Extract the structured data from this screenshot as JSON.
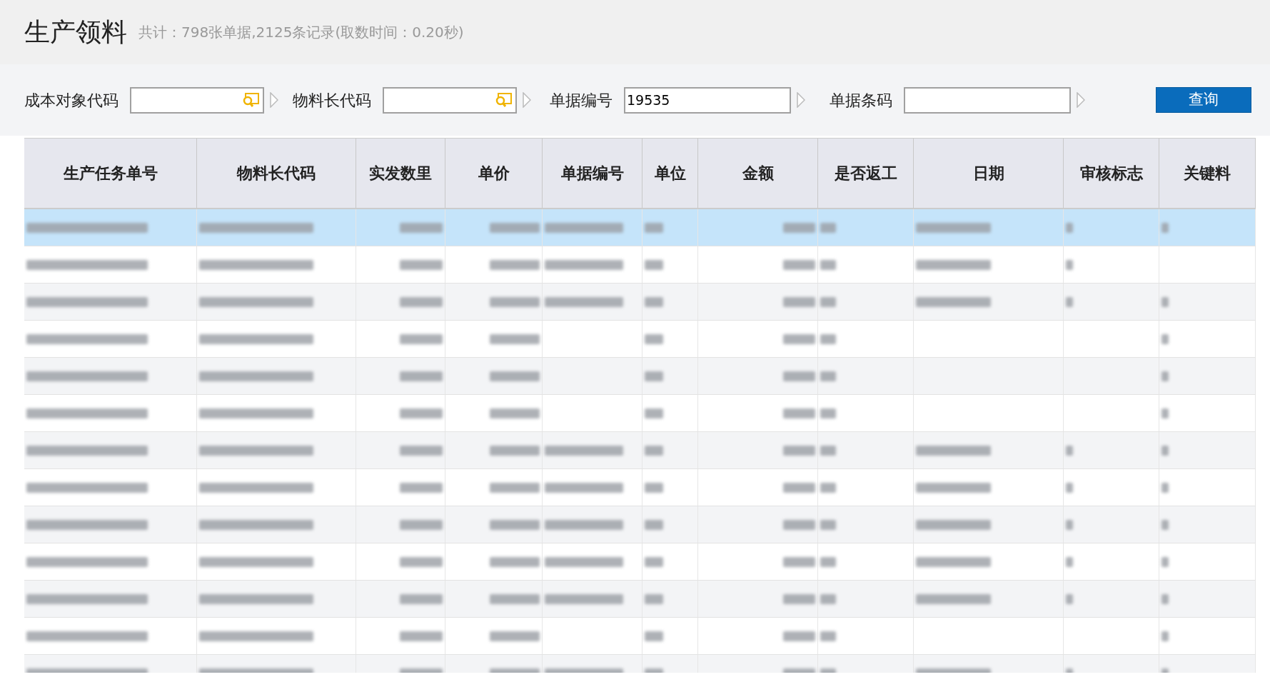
{
  "title": "生产领料",
  "summary": "共计：798张单据,2125条记录(取数时间：0.20秒)",
  "filters": [
    {
      "label": "成本对象代码",
      "kind": "lookup"
    },
    {
      "label": "物料长代码",
      "kind": "lookup"
    },
    {
      "label": "单据编号",
      "kind": "text",
      "value": "19535"
    },
    {
      "label": "单据条码",
      "kind": "text"
    }
  ],
  "query_button": "查询",
  "table": {
    "columns": [
      {
        "label": "生产任务单号",
        "kind": "text"
      },
      {
        "label": "物料长代码",
        "kind": "text"
      },
      {
        "label": "实发数里",
        "kind": "number"
      },
      {
        "label": "单价",
        "kind": "number"
      },
      {
        "label": "单据编号",
        "kind": "text"
      },
      {
        "label": "单位",
        "kind": "text"
      },
      {
        "label": "金额",
        "kind": "number"
      },
      {
        "label": "是否返工",
        "kind": "text"
      },
      {
        "label": "日期",
        "kind": "text"
      },
      {
        "label": "审核标志",
        "kind": "text"
      },
      {
        "label": "关键料",
        "kind": "text"
      }
    ],
    "rows": [
      {
        "selected": true,
        "redacted_cells": [
          true,
          true,
          true,
          true,
          true,
          true,
          true,
          true,
          true,
          true,
          true
        ]
      },
      {
        "selected": false,
        "redacted_cells": [
          true,
          true,
          true,
          true,
          true,
          true,
          true,
          true,
          true,
          true,
          false
        ]
      },
      {
        "selected": false,
        "redacted_cells": [
          true,
          true,
          true,
          true,
          true,
          true,
          true,
          true,
          true,
          true,
          true
        ]
      },
      {
        "selected": false,
        "redacted_cells": [
          true,
          true,
          true,
          true,
          false,
          true,
          true,
          true,
          false,
          false,
          true
        ]
      },
      {
        "selected": false,
        "redacted_cells": [
          true,
          true,
          true,
          true,
          false,
          true,
          true,
          true,
          false,
          false,
          true
        ]
      },
      {
        "selected": false,
        "redacted_cells": [
          true,
          true,
          true,
          true,
          false,
          true,
          true,
          true,
          false,
          false,
          true
        ]
      },
      {
        "selected": false,
        "redacted_cells": [
          true,
          true,
          true,
          true,
          true,
          true,
          true,
          true,
          true,
          true,
          true
        ]
      },
      {
        "selected": false,
        "redacted_cells": [
          true,
          true,
          true,
          true,
          true,
          true,
          true,
          true,
          true,
          true,
          true
        ]
      },
      {
        "selected": false,
        "redacted_cells": [
          true,
          true,
          true,
          true,
          true,
          true,
          true,
          true,
          true,
          true,
          true
        ]
      },
      {
        "selected": false,
        "redacted_cells": [
          true,
          true,
          true,
          true,
          true,
          true,
          true,
          true,
          true,
          true,
          true
        ]
      },
      {
        "selected": false,
        "redacted_cells": [
          true,
          true,
          true,
          true,
          true,
          true,
          true,
          true,
          true,
          true,
          true
        ]
      },
      {
        "selected": false,
        "redacted_cells": [
          true,
          true,
          true,
          true,
          false,
          true,
          true,
          true,
          false,
          false,
          true
        ]
      },
      {
        "selected": false,
        "redacted_cells": [
          true,
          true,
          true,
          true,
          true,
          true,
          true,
          true,
          true,
          true,
          true
        ]
      }
    ]
  }
}
